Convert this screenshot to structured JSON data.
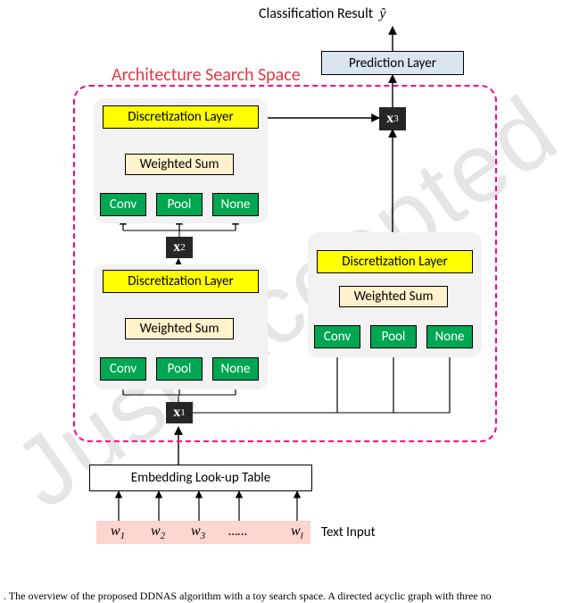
{
  "header": {
    "classification_label": "Classification Result",
    "yhat": "ŷ"
  },
  "prediction_layer": "Prediction Layer",
  "search_space_title": "Architecture Search Space",
  "module": {
    "discretization": "Discretization Layer",
    "weighted_sum": "Weighted Sum",
    "ops": {
      "conv": "Conv",
      "pool": "Pool",
      "none": "None"
    }
  },
  "nodes": {
    "x1": "x",
    "x1_sub": "1",
    "x2": "x",
    "x2_sub": "2",
    "x3": "x",
    "x3_sub": "3"
  },
  "embedding": "Embedding Look-up Table",
  "text_input_label": "Text Input",
  "tokens": {
    "w1": "w",
    "w1_sub": "1",
    "w2": "w",
    "w2_sub": "2",
    "w3": "w",
    "w3_sub": "3",
    "dots": "……",
    "wl": "w",
    "wl_sub": "l"
  },
  "caption_line1": ".  The overview of the proposed DDNAS algorithm with a toy search space. A directed acyclic graph with three no",
  "watermark": "Just Accepted"
}
